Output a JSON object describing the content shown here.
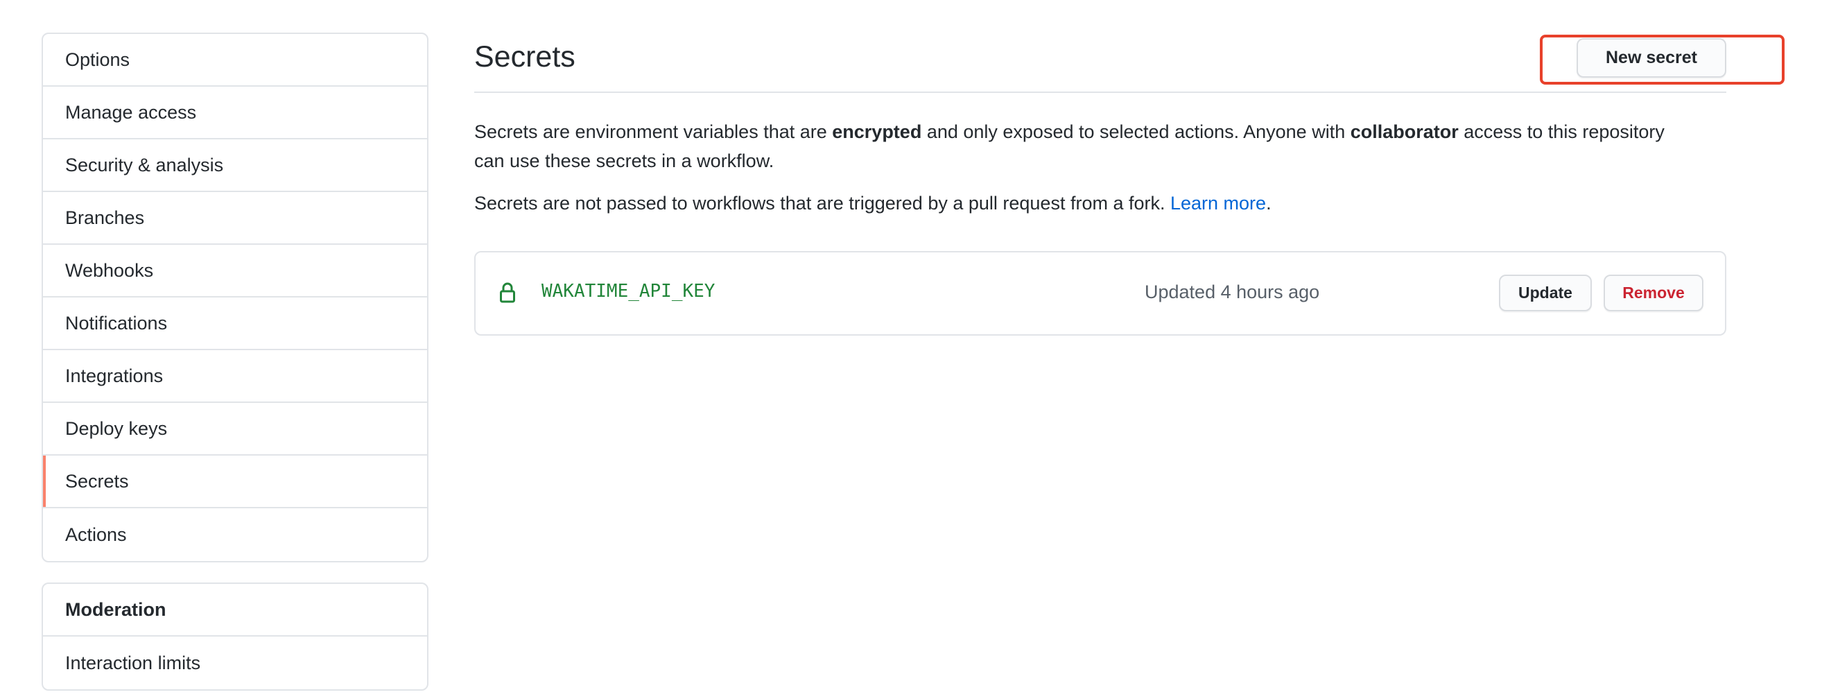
{
  "sidebar": {
    "items": [
      {
        "label": "Options"
      },
      {
        "label": "Manage access"
      },
      {
        "label": "Security & analysis"
      },
      {
        "label": "Branches"
      },
      {
        "label": "Webhooks"
      },
      {
        "label": "Notifications"
      },
      {
        "label": "Integrations"
      },
      {
        "label": "Deploy keys"
      },
      {
        "label": "Secrets",
        "active": true
      },
      {
        "label": "Actions"
      }
    ],
    "moderation": {
      "heading": "Moderation",
      "items": [
        {
          "label": "Interaction limits"
        }
      ]
    }
  },
  "main": {
    "title": "Secrets",
    "new_secret_label": "New secret",
    "intro": {
      "p1_a": "Secrets are environment variables that are ",
      "p1_b": "encrypted",
      "p1_c": " and only exposed to selected actions. Anyone with ",
      "p1_d": "collaborator",
      "p1_e": " access to this repository can use these secrets in a workflow.",
      "p2_a": "Secrets are not passed to workflows that are triggered by a pull request from a fork. ",
      "p2_link": "Learn more",
      "p2_end": "."
    },
    "secrets": [
      {
        "name": "WAKATIME_API_KEY",
        "updated": "Updated 4 hours ago",
        "icon": "lock-icon",
        "update_label": "Update",
        "remove_label": "Remove"
      }
    ]
  },
  "colors": {
    "active_indicator": "#f9826c",
    "secret_name": "#22863a",
    "link": "#0366d6",
    "danger": "#cb2431",
    "highlight_box": "#e8412b"
  }
}
